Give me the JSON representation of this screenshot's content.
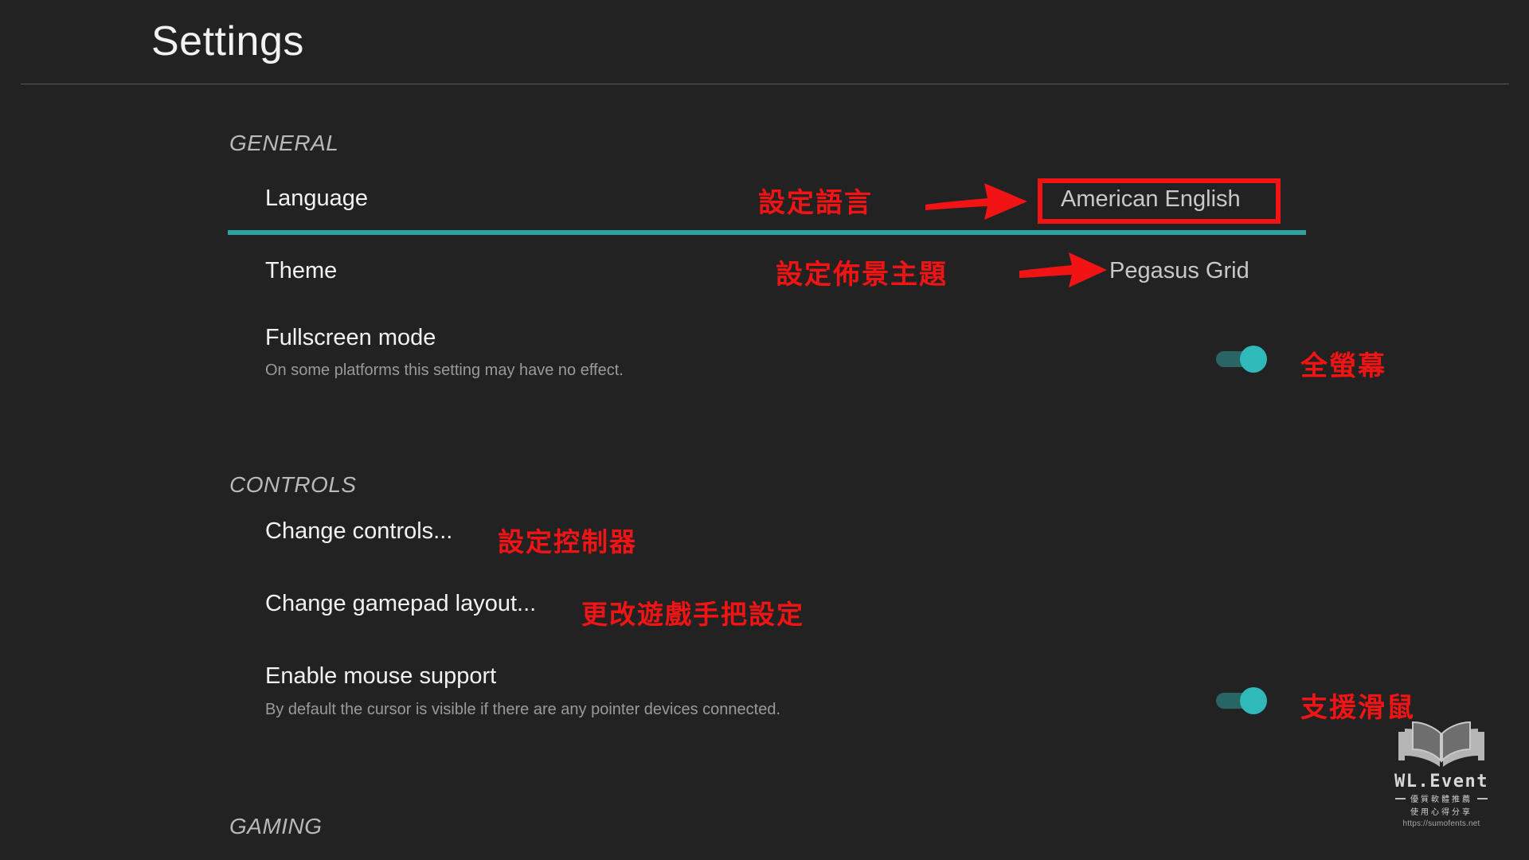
{
  "header": {
    "title": "Settings"
  },
  "sections": {
    "general": {
      "label": "GENERAL",
      "rows": {
        "language": {
          "label": "Language",
          "value": "American English",
          "annotation": "設定語言",
          "selected": true
        },
        "theme": {
          "label": "Theme",
          "value": "Pegasus Grid",
          "annotation": "設定佈景主題"
        },
        "fullscreen": {
          "label": "Fullscreen mode",
          "description": "On some platforms this setting may have no effect.",
          "toggle_state": "on",
          "annotation": "全螢幕"
        }
      }
    },
    "controls": {
      "label": "CONTROLS",
      "rows": {
        "change_controls": {
          "label": "Change controls...",
          "annotation": "設定控制器"
        },
        "change_gamepad": {
          "label": "Change gamepad layout...",
          "annotation": "更改遊戲手把設定"
        },
        "mouse_support": {
          "label": "Enable mouse support",
          "description": "By default the cursor is visible if there are any pointer devices connected.",
          "toggle_state": "on",
          "annotation": "支援滑鼠"
        }
      }
    },
    "gaming": {
      "label": "GAMING"
    }
  },
  "watermark": {
    "brand": "WL.Event",
    "tagline_line1": "優質軟體推薦",
    "tagline_line2": "使用心得分享",
    "url": "https://sumofents.net"
  },
  "colors": {
    "background": "#222222",
    "accent_teal": "#2da3a3",
    "toggle_knob": "#2fb9b9",
    "toggle_track": "#2a6566",
    "annotation_red": "#f21414",
    "text_primary": "#f2f2f2",
    "text_secondary": "#9a9a9a",
    "section_header": "#b9b9b9"
  }
}
